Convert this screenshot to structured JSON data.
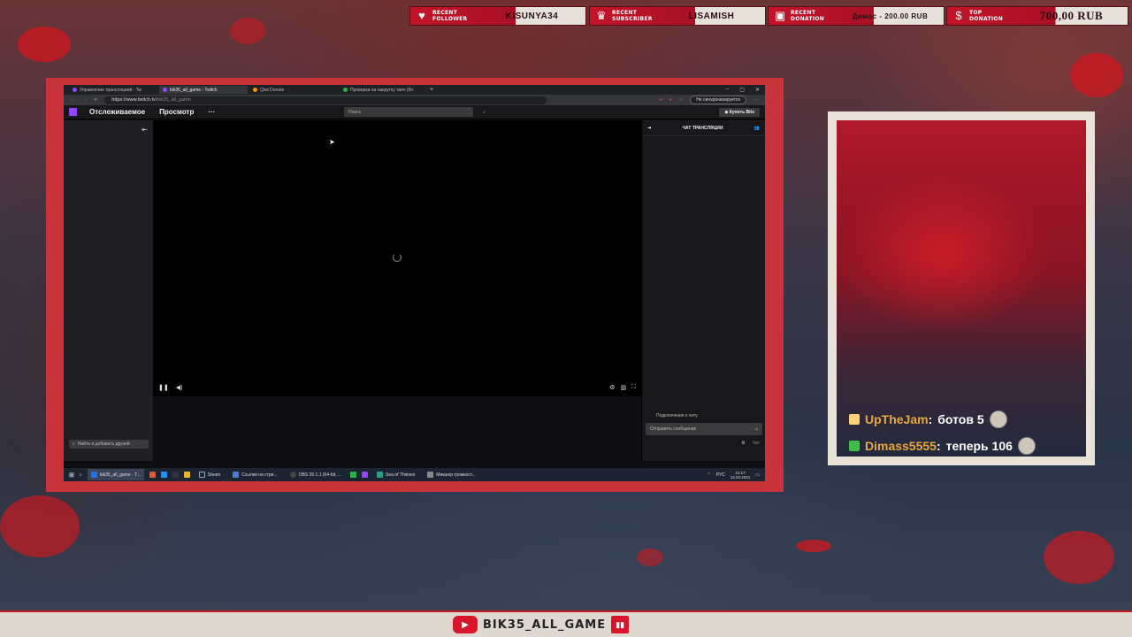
{
  "alerts": [
    {
      "icon": "heart-icon",
      "label": "RECENT FOLLOWER",
      "value": "KISUNYA34"
    },
    {
      "icon": "trophy-icon",
      "label": "RECENT SUBSCRIBER",
      "value": "LISAMISH"
    },
    {
      "icon": "cash-icon",
      "label": "RECENT DONATION",
      "value": "Димас - 200.00 RUB"
    },
    {
      "icon": "money-bag-icon",
      "label": "TOP DONATION",
      "value": "700,00 RUB"
    }
  ],
  "browser": {
    "tabs": [
      {
        "label": "Управление трансляцией - Tw",
        "color": "#9147ff",
        "active": false
      },
      {
        "label": "bik35_all_game - Twitch",
        "color": "#9147ff",
        "active": true
      },
      {
        "label": "Qiwi Donate",
        "color": "#ff8c00",
        "active": false
      },
      {
        "label": "Проверка на накрутку твич (бо",
        "color": "#2bb24c",
        "active": false
      }
    ],
    "url_prefix": "https://www.twitch.tv",
    "url_path": "/bik35_all_game",
    "sync_label": "Не синхронизируется"
  },
  "twitch": {
    "nav_following": "Отслеживаемое",
    "nav_browse": "Просмотр",
    "nav_more": "···",
    "search_placeholder": "Поиск",
    "buy_bits": "Купить Bits",
    "find_friends": "Найти и добавить друзей",
    "chat_title": "ЧАТ ТРАНСЛЯЦИИ",
    "chat_connecting": "Подключение к чату",
    "chat_send_placeholder": "Отправить сообщение",
    "chat_button": "Чат"
  },
  "taskbar": {
    "items": [
      {
        "label": "bik35_all_game - T...",
        "active": true,
        "color": "#1a73e8"
      },
      {
        "label": "Steam",
        "active": false,
        "color": "#1b2838"
      },
      {
        "label": "Ссылки на стри...",
        "active": false,
        "color": "#4a7bd6"
      },
      {
        "label": "OBS 26.1.1 (64-bit, ...",
        "active": false,
        "color": "#444"
      },
      {
        "label": "Sea of Thieves",
        "active": false,
        "color": "#2a9d8f"
      },
      {
        "label": "Микшер громкост...",
        "active": false,
        "color": "#888"
      }
    ],
    "lang": "РУС",
    "time": "21:17",
    "date": "12.03.2021"
  },
  "chat_messages": [
    {
      "nick": "UpTheJam",
      "text": "ботов 5",
      "badge_color": "#ffd07a"
    },
    {
      "nick": "Dimass5555",
      "text": "теперь 106",
      "badge_color": "#3fbf4a"
    }
  ],
  "bottom": {
    "channel": "BIK35_ALL_GAME"
  },
  "colors": {
    "accent_red": "#c61a22",
    "twitch_purple": "#9147ff",
    "nick_gold": "#e8a83c"
  }
}
